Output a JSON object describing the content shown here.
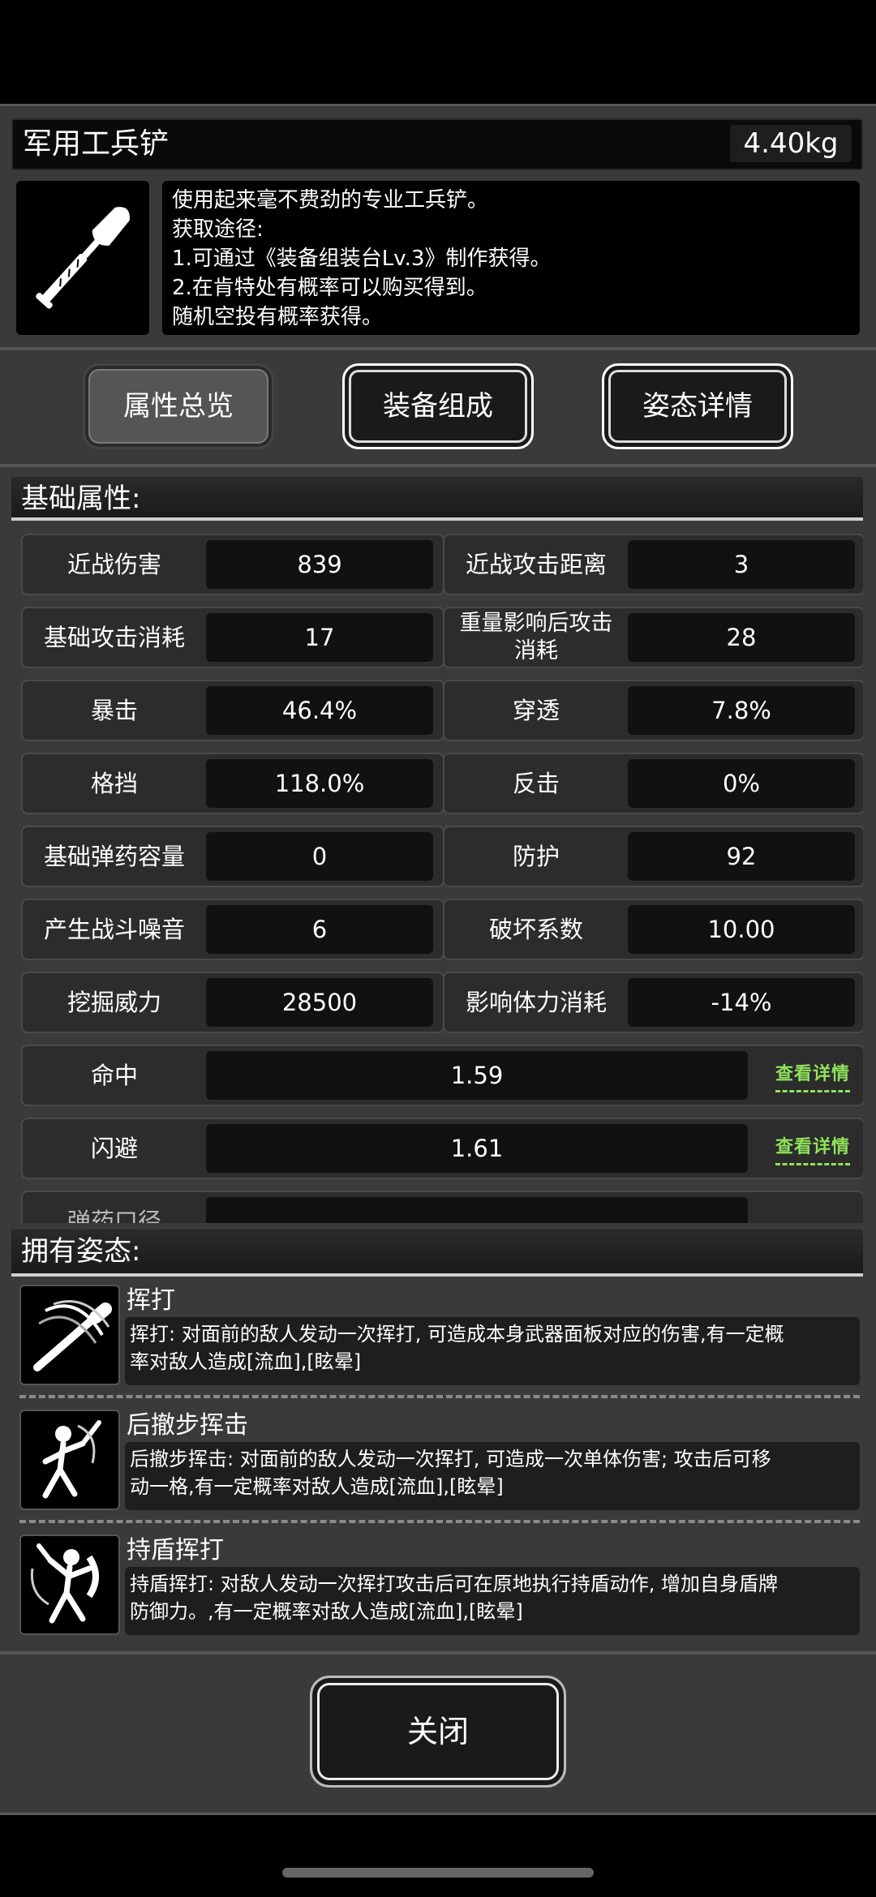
{
  "item": {
    "name": "军用工兵铲",
    "weight": "4.40kg",
    "description": [
      "使用起来毫不费劲的专业工兵铲。",
      "获取途径:",
      "1.可通过《装备组装台Lv.3》制作获得。",
      "2.在肯特处有概率可以购买得到。",
      "随机空投有概率获得。"
    ],
    "image_icon": "shovel-icon"
  },
  "tabs": [
    {
      "label": "属性总览",
      "active": true
    },
    {
      "label": "装备组成",
      "active": false
    },
    {
      "label": "姿态详情",
      "active": false
    }
  ],
  "base_section": {
    "title": "基础属性:"
  },
  "stats": [
    {
      "label": "近战伤害",
      "value": "839"
    },
    {
      "label": "近战攻击距离",
      "value": "3"
    },
    {
      "label": "基础攻击消耗",
      "value": "17"
    },
    {
      "label": "重量影响后攻击消耗",
      "value": "28"
    },
    {
      "label": "暴击",
      "value": "46.4%"
    },
    {
      "label": "穿透",
      "value": "7.8%"
    },
    {
      "label": "格挡",
      "value": "118.0%"
    },
    {
      "label": "反击",
      "value": "0%"
    },
    {
      "label": "基础弹药容量",
      "value": "0"
    },
    {
      "label": "防护",
      "value": "92"
    },
    {
      "label": "产生战斗噪音",
      "value": "6"
    },
    {
      "label": "破坏系数",
      "value": "10.00"
    },
    {
      "label": "挖掘威力",
      "value": "28500"
    },
    {
      "label": "影响体力消耗",
      "value": "-14%"
    }
  ],
  "wide_stats": [
    {
      "label": "命中",
      "value": "1.59",
      "link": "查看详情"
    },
    {
      "label": "闪避",
      "value": "1.61",
      "link": "查看详情"
    }
  ],
  "clipped_stat": {
    "label": "弹药口径"
  },
  "stance_section": {
    "title": "拥有姿态:"
  },
  "stances": [
    {
      "name": "挥打",
      "icon": "swing-attack-icon",
      "desc_lines": [
        "挥打: 对面前的敌人发动一次挥打, 可造成本身武器面板对应的伤害,有一定概",
        "率对敌人造成[流血],[眩晕]"
      ]
    },
    {
      "name": "后撤步挥击",
      "icon": "backstep-swing-icon",
      "desc_lines": [
        "后撤步挥击: 对面前的敌人发动一次挥打, 可造成一次单体伤害; 攻击后可移",
        "动一格,有一定概率对敌人造成[流血],[眩晕]"
      ]
    },
    {
      "name": "持盾挥打",
      "icon": "shield-swing-icon",
      "desc_lines": [
        "持盾挥打: 对敌人发动一次挥打攻击后可在原地执行持盾动作, 增加自身盾牌",
        "防御力。,有一定概率对敌人造成[流血],[眩晕]"
      ]
    }
  ],
  "close_button": {
    "label": "关闭"
  }
}
